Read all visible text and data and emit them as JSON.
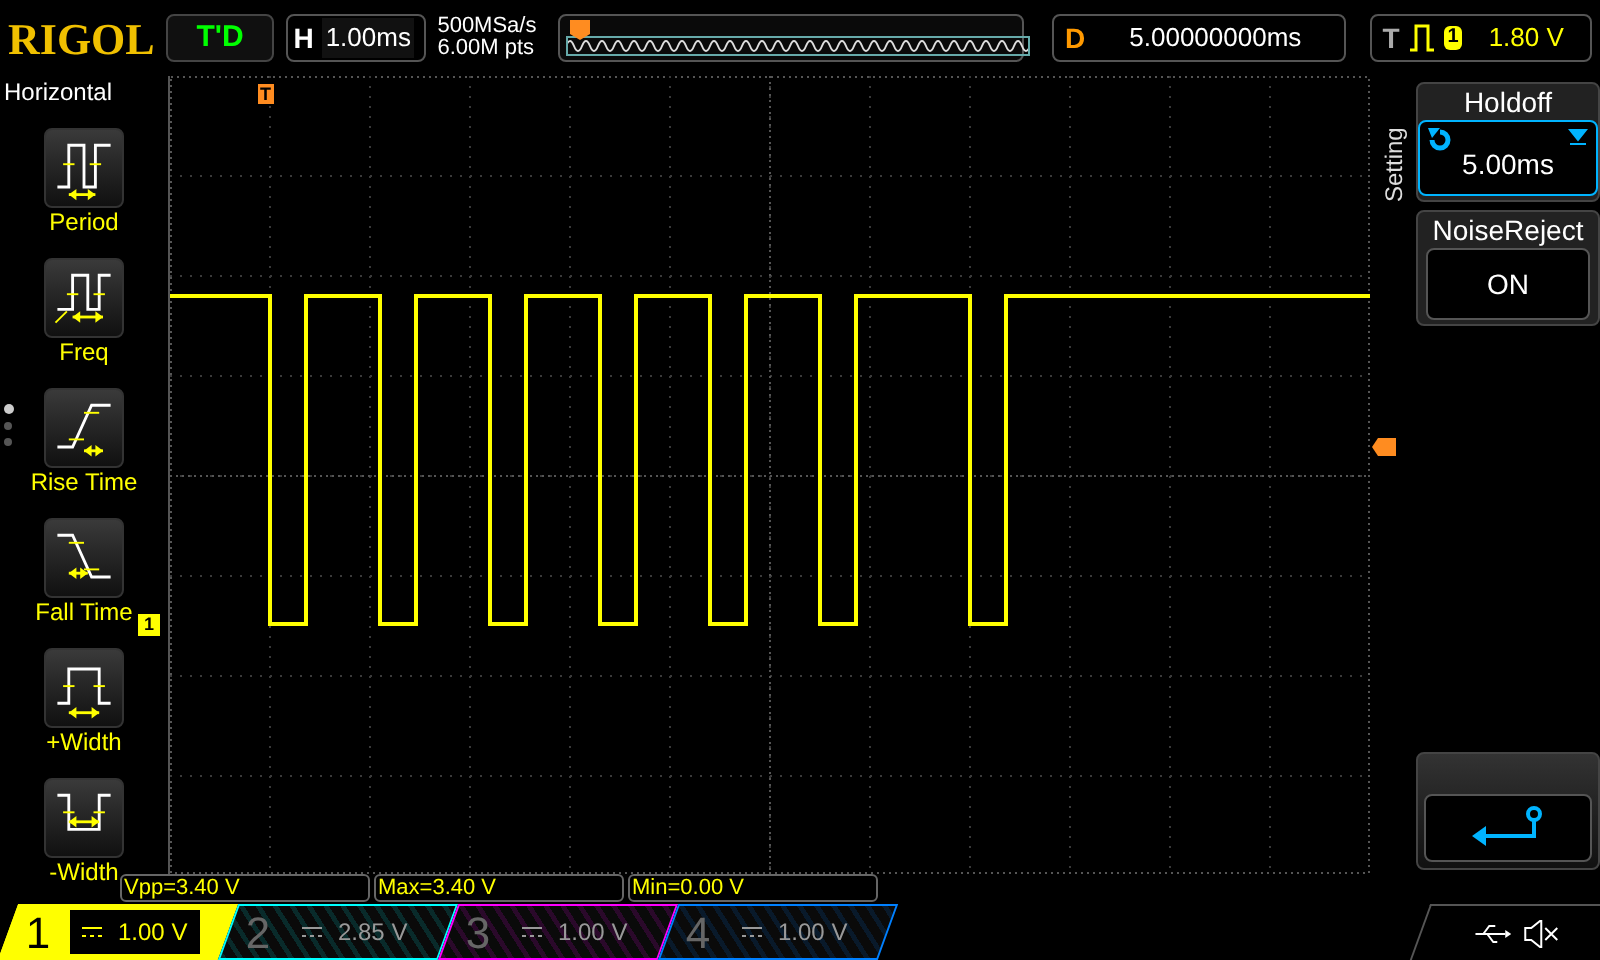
{
  "top_bar": {
    "logo": "RIGOL",
    "run_status": "T'D",
    "horizontal": {
      "label": "H",
      "value": "1.00ms"
    },
    "sample_rate": "500MSa/s",
    "memory_depth": "6.00M pts",
    "delay": {
      "label": "D",
      "value": "5.00000000ms"
    },
    "trigger": {
      "label": "T",
      "source": "1",
      "level": "1.80 V"
    }
  },
  "menu": {
    "title": "Horizontal",
    "page_dots": [
      {
        "selected": true
      },
      {
        "selected": false
      },
      {
        "selected": false
      }
    ],
    "items": [
      {
        "kind": "period",
        "label": "Period"
      },
      {
        "kind": "freq",
        "label": "Freq"
      },
      {
        "kind": "rise",
        "label": "Rise Time"
      },
      {
        "kind": "fall",
        "label": "Fall Time"
      },
      {
        "kind": "pos_width",
        "label": "+Width"
      },
      {
        "kind": "neg_width",
        "label": "-Width"
      }
    ]
  },
  "plot": {
    "trigger_position_marker": "T",
    "channel_marker": "1"
  },
  "side_menu": {
    "title": "Setting",
    "holdoff": {
      "label": "Holdoff",
      "value": "5.00ms"
    },
    "noise_reject": {
      "label": "NoiseReject",
      "value": "ON"
    }
  },
  "measurements": [
    "Vpp=3.40 V",
    "Max=3.40 V",
    "Min=0.00 V"
  ],
  "channels": [
    {
      "number": "1",
      "scale": "1.00 V",
      "color": "#ffff00",
      "selected": true
    },
    {
      "number": "2",
      "scale": "2.85 V",
      "color": "#00ffff",
      "selected": false
    },
    {
      "number": "3",
      "scale": "1.00 V",
      "color": "#ff00ff",
      "selected": false
    },
    {
      "number": "4",
      "scale": "1.00 V",
      "color": "#0080ff",
      "selected": false
    }
  ]
}
